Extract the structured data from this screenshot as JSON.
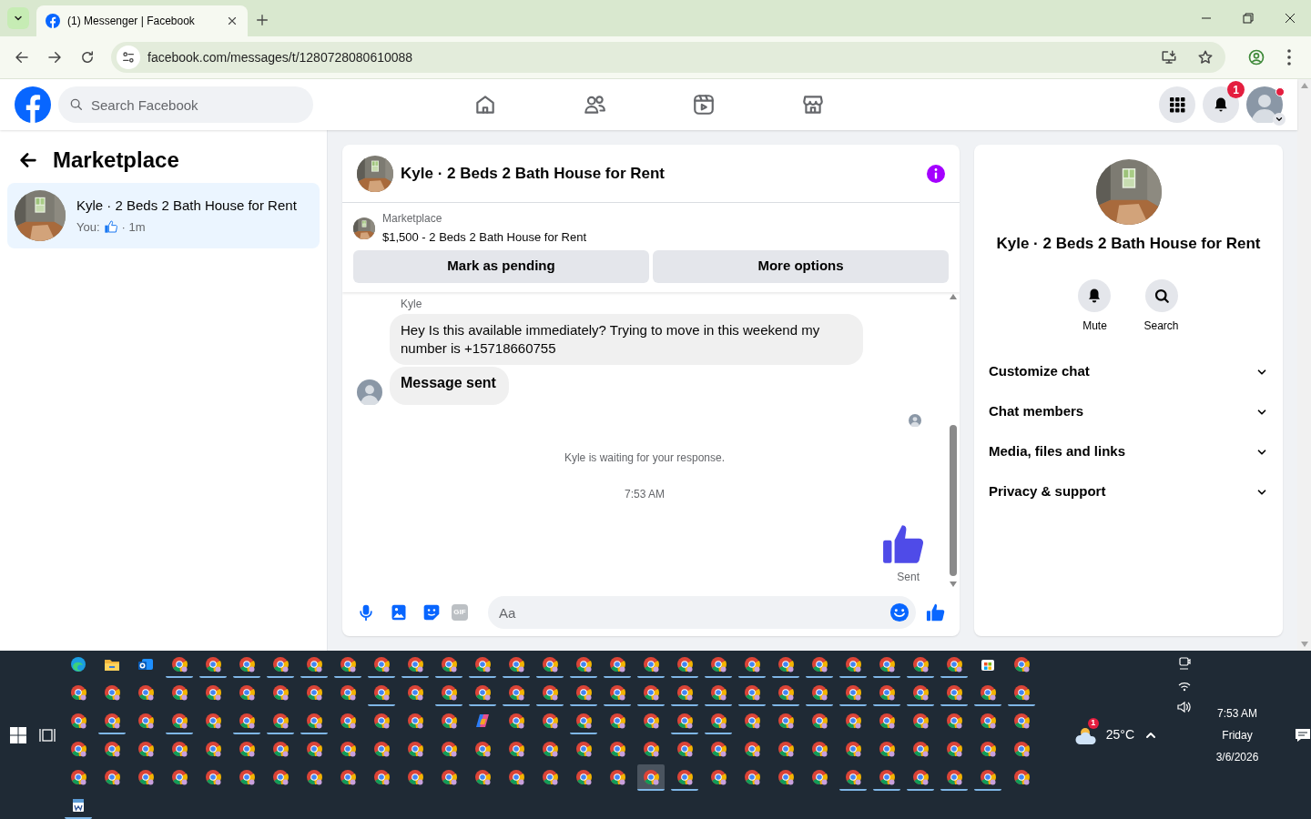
{
  "browser": {
    "tab_title": "(1) Messenger | Facebook",
    "url": "facebook.com/messages/t/1280728080610088"
  },
  "header": {
    "search_placeholder": "Search Facebook",
    "notification_count": "1"
  },
  "sidebar": {
    "title": "Marketplace",
    "threads": [
      {
        "name": "Kyle · 2 Beds 2 Bath House for Rent",
        "preview_prefix": "You:",
        "time": "· 1m",
        "selected": true
      }
    ]
  },
  "chat": {
    "title": "Kyle · 2 Beds 2 Bath House for Rent",
    "listing": {
      "source": "Marketplace",
      "title": "$1,500 - 2 Beds 2 Bath House for Rent"
    },
    "actions": [
      "Mark as pending",
      "More options"
    ],
    "sender": "Kyle",
    "messages": [
      {
        "kind": "text",
        "text": "Hey Is this available immediately? Trying to move in this weekend my number is +15718660755"
      },
      {
        "kind": "notice",
        "text": "Message sent"
      }
    ],
    "status": "Kyle is waiting for your response.",
    "time": "7:53 AM",
    "delivery": "Sent",
    "composer": {
      "placeholder": "Aa",
      "gif_label": "GIF"
    }
  },
  "details": {
    "title": "Kyle · 2 Beds 2 Bath House for Rent",
    "actions": [
      {
        "kind": "mute",
        "label": "Mute"
      },
      {
        "kind": "search",
        "label": "Search"
      }
    ],
    "sections": [
      {
        "label": "Customize chat",
        "expanded": false
      },
      {
        "label": "Chat members",
        "expanded": false
      },
      {
        "label": "Media, files and links",
        "expanded": false
      },
      {
        "label": "Privacy & support",
        "expanded": false
      }
    ]
  },
  "taskbar": {
    "rows": [
      {
        "icons": [
          {
            "kind": "edge",
            "running": false,
            "selected": false
          },
          {
            "kind": "folder",
            "running": false,
            "selected": false
          },
          {
            "kind": "mail",
            "running": false,
            "selected": false
          },
          {
            "kind": "browser",
            "running": true,
            "selected": false
          },
          {
            "kind": "browser",
            "running": true,
            "selected": false
          },
          {
            "kind": "browser",
            "running": true,
            "selected": false
          },
          {
            "kind": "browser",
            "running": true,
            "selected": false
          },
          {
            "kind": "browser",
            "running": true,
            "selected": false
          },
          {
            "kind": "browser",
            "running": true,
            "selected": false
          },
          {
            "kind": "browser",
            "running": true,
            "selected": false
          },
          {
            "kind": "browser",
            "running": true,
            "selected": false
          },
          {
            "kind": "browser",
            "running": true,
            "selected": false
          },
          {
            "kind": "browser",
            "running": true,
            "selected": false
          },
          {
            "kind": "browser",
            "running": true,
            "selected": false
          },
          {
            "kind": "browser",
            "running": true,
            "selected": false
          },
          {
            "kind": "browser",
            "running": true,
            "selected": false
          },
          {
            "kind": "browser",
            "running": true,
            "selected": false
          },
          {
            "kind": "browser",
            "running": true,
            "selected": false
          },
          {
            "kind": "browser",
            "running": true,
            "selected": false
          },
          {
            "kind": "browser",
            "running": true,
            "selected": false
          },
          {
            "kind": "browser",
            "running": true,
            "selected": false
          },
          {
            "kind": "browser",
            "running": true,
            "selected": false
          },
          {
            "kind": "browser",
            "running": true,
            "selected": false
          },
          {
            "kind": "browser",
            "running": true,
            "selected": false
          },
          {
            "kind": "browser",
            "running": true,
            "selected": false
          },
          {
            "kind": "browser",
            "running": true,
            "selected": false
          },
          {
            "kind": "browser",
            "running": true,
            "selected": false
          },
          {
            "kind": "store",
            "running": false,
            "selected": false
          },
          {
            "kind": "browser",
            "running": false,
            "selected": false
          }
        ]
      },
      {
        "icons": [
          {
            "kind": "browser",
            "running": false,
            "selected": false
          },
          {
            "kind": "browser",
            "running": false,
            "selected": false
          },
          {
            "kind": "browser",
            "running": false,
            "selected": false
          },
          {
            "kind": "browser",
            "running": false,
            "selected": false
          },
          {
            "kind": "browser",
            "running": false,
            "selected": false
          },
          {
            "kind": "browser",
            "running": false,
            "selected": false
          },
          {
            "kind": "browser",
            "running": false,
            "selected": false
          },
          {
            "kind": "browser",
            "running": false,
            "selected": false
          },
          {
            "kind": "browser",
            "running": false,
            "selected": false
          },
          {
            "kind": "browser",
            "running": true,
            "selected": false
          },
          {
            "kind": "browser",
            "running": false,
            "selected": false
          },
          {
            "kind": "browser",
            "running": true,
            "selected": false
          },
          {
            "kind": "browser",
            "running": true,
            "selected": false
          },
          {
            "kind": "browser",
            "running": true,
            "selected": false
          },
          {
            "kind": "browser",
            "running": true,
            "selected": false
          },
          {
            "kind": "browser",
            "running": true,
            "selected": false
          },
          {
            "kind": "browser",
            "running": true,
            "selected": false
          },
          {
            "kind": "browser",
            "running": true,
            "selected": false
          },
          {
            "kind": "browser",
            "running": true,
            "selected": false
          },
          {
            "kind": "browser",
            "running": true,
            "selected": false
          },
          {
            "kind": "browser",
            "running": true,
            "selected": false
          },
          {
            "kind": "browser",
            "running": true,
            "selected": false
          },
          {
            "kind": "browser",
            "running": true,
            "selected": false
          },
          {
            "kind": "browser",
            "running": true,
            "selected": false
          },
          {
            "kind": "browser",
            "running": true,
            "selected": false
          },
          {
            "kind": "browser",
            "running": true,
            "selected": false
          },
          {
            "kind": "browser",
            "running": true,
            "selected": false
          },
          {
            "kind": "browser",
            "running": true,
            "selected": false
          },
          {
            "kind": "browser",
            "running": true,
            "selected": false
          }
        ]
      },
      {
        "icons": [
          {
            "kind": "browser",
            "running": false,
            "selected": false
          },
          {
            "kind": "browser",
            "running": true,
            "selected": false
          },
          {
            "kind": "browser",
            "running": false,
            "selected": false
          },
          {
            "kind": "browser",
            "running": true,
            "selected": false
          },
          {
            "kind": "browser",
            "running": false,
            "selected": false
          },
          {
            "kind": "browser",
            "running": true,
            "selected": false
          },
          {
            "kind": "browser",
            "running": true,
            "selected": false
          },
          {
            "kind": "browser",
            "running": true,
            "selected": false
          },
          {
            "kind": "browser",
            "running": false,
            "selected": false
          },
          {
            "kind": "browser",
            "running": false,
            "selected": false
          },
          {
            "kind": "browser",
            "running": false,
            "selected": false
          },
          {
            "kind": "browser",
            "running": false,
            "selected": false
          },
          {
            "kind": "copilot",
            "running": false,
            "selected": false
          },
          {
            "kind": "browser",
            "running": false,
            "selected": false
          },
          {
            "kind": "browser",
            "running": false,
            "selected": false
          },
          {
            "kind": "browser",
            "running": true,
            "selected": false
          },
          {
            "kind": "browser",
            "running": false,
            "selected": false
          },
          {
            "kind": "browser",
            "running": false,
            "selected": false
          },
          {
            "kind": "browser",
            "running": true,
            "selected": false
          },
          {
            "kind": "browser",
            "running": true,
            "selected": false
          },
          {
            "kind": "browser",
            "running": false,
            "selected": false
          },
          {
            "kind": "browser",
            "running": false,
            "selected": false
          },
          {
            "kind": "browser",
            "running": false,
            "selected": false
          },
          {
            "kind": "browser",
            "running": false,
            "selected": false
          },
          {
            "kind": "browser",
            "running": false,
            "selected": false
          },
          {
            "kind": "browser",
            "running": false,
            "selected": false
          },
          {
            "kind": "browser",
            "running": false,
            "selected": false
          },
          {
            "kind": "browser",
            "running": false,
            "selected": false
          },
          {
            "kind": "browser",
            "running": false,
            "selected": false
          }
        ]
      },
      {
        "icons": [
          {
            "kind": "browser",
            "running": false,
            "selected": false
          },
          {
            "kind": "browser",
            "running": false,
            "selected": false
          },
          {
            "kind": "browser",
            "running": false,
            "selected": false
          },
          {
            "kind": "browser",
            "running": false,
            "selected": false
          },
          {
            "kind": "browser",
            "running": false,
            "selected": false
          },
          {
            "kind": "browser",
            "running": false,
            "selected": false
          },
          {
            "kind": "browser",
            "running": false,
            "selected": false
          },
          {
            "kind": "browser",
            "running": false,
            "selected": false
          },
          {
            "kind": "browser",
            "running": false,
            "selected": false
          },
          {
            "kind": "browser",
            "running": false,
            "selected": false
          },
          {
            "kind": "browser",
            "running": false,
            "selected": false
          },
          {
            "kind": "browser",
            "running": false,
            "selected": false
          },
          {
            "kind": "browser",
            "running": false,
            "selected": false
          },
          {
            "kind": "browser",
            "running": false,
            "selected": false
          },
          {
            "kind": "browser",
            "running": false,
            "selected": false
          },
          {
            "kind": "browser",
            "running": false,
            "selected": false
          },
          {
            "kind": "browser",
            "running": false,
            "selected": false
          },
          {
            "kind": "browser",
            "running": false,
            "selected": false
          },
          {
            "kind": "browser",
            "running": false,
            "selected": false
          },
          {
            "kind": "browser",
            "running": false,
            "selected": false
          },
          {
            "kind": "browser",
            "running": false,
            "selected": false
          },
          {
            "kind": "browser",
            "running": false,
            "selected": false
          },
          {
            "kind": "browser",
            "running": false,
            "selected": false
          },
          {
            "kind": "browser",
            "running": false,
            "selected": false
          },
          {
            "kind": "browser",
            "running": false,
            "selected": false
          },
          {
            "kind": "browser",
            "running": false,
            "selected": false
          },
          {
            "kind": "browser",
            "running": false,
            "selected": false
          },
          {
            "kind": "browser",
            "running": false,
            "selected": false
          },
          {
            "kind": "browser",
            "running": false,
            "selected": false
          }
        ]
      },
      {
        "icons": [
          {
            "kind": "browser",
            "running": false,
            "selected": false
          },
          {
            "kind": "browser",
            "running": false,
            "selected": false
          },
          {
            "kind": "browser",
            "running": false,
            "selected": false
          },
          {
            "kind": "browser",
            "running": false,
            "selected": false
          },
          {
            "kind": "browser",
            "running": false,
            "selected": false
          },
          {
            "kind": "browser",
            "running": false,
            "selected": false
          },
          {
            "kind": "browser",
            "running": false,
            "selected": false
          },
          {
            "kind": "browser",
            "running": false,
            "selected": false
          },
          {
            "kind": "browser",
            "running": false,
            "selected": false
          },
          {
            "kind": "browser",
            "running": false,
            "selected": false
          },
          {
            "kind": "browser",
            "running": false,
            "selected": false
          },
          {
            "kind": "browser",
            "running": false,
            "selected": false
          },
          {
            "kind": "browser",
            "running": false,
            "selected": false
          },
          {
            "kind": "browser",
            "running": false,
            "selected": false
          },
          {
            "kind": "browser",
            "running": false,
            "selected": false
          },
          {
            "kind": "browser",
            "running": false,
            "selected": false
          },
          {
            "kind": "browser",
            "running": false,
            "selected": false
          },
          {
            "kind": "browser",
            "running": true,
            "selected": true
          },
          {
            "kind": "browser",
            "running": true,
            "selected": false
          },
          {
            "kind": "browser",
            "running": false,
            "selected": false
          },
          {
            "kind": "browser",
            "running": false,
            "selected": false
          },
          {
            "kind": "browser",
            "running": false,
            "selected": false
          },
          {
            "kind": "browser",
            "running": false,
            "selected": false
          },
          {
            "kind": "browser",
            "running": true,
            "selected": false
          },
          {
            "kind": "browser",
            "running": true,
            "selected": false
          },
          {
            "kind": "browser",
            "running": true,
            "selected": false
          },
          {
            "kind": "browser",
            "running": true,
            "selected": false
          },
          {
            "kind": "browser",
            "running": true,
            "selected": false
          },
          {
            "kind": "browser",
            "running": false,
            "selected": false
          }
        ]
      },
      {
        "icons": [
          {
            "kind": "doc",
            "running": true,
            "selected": false
          }
        ]
      }
    ],
    "weather": {
      "temperature": "25°C",
      "badge": "1"
    },
    "clock": {
      "time": "7:53 AM",
      "day": "Friday",
      "date": "3/6/2026"
    }
  }
}
